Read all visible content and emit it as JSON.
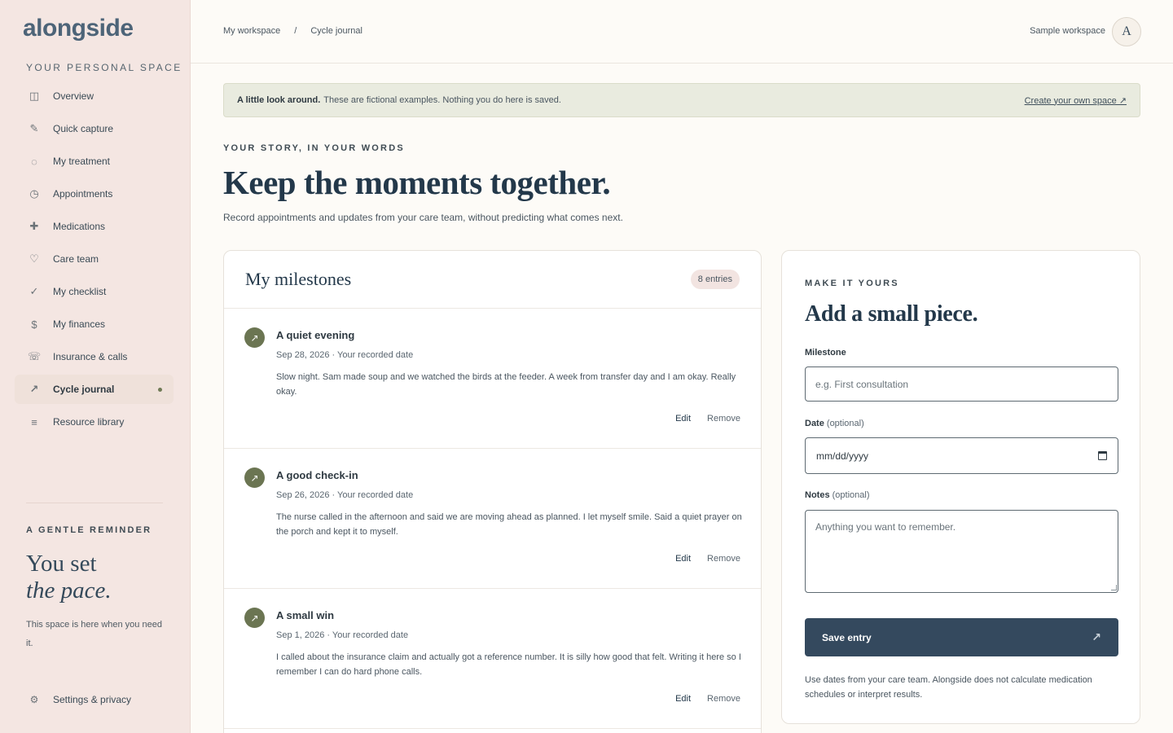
{
  "app": {
    "logo": "alongside",
    "sidebar_caption": "YOUR PERSONAL SPACE"
  },
  "sidebar": {
    "items": [
      {
        "label": "Overview",
        "icon": "layout-icon",
        "glyph": "◫"
      },
      {
        "label": "Quick capture",
        "icon": "pencil-icon",
        "glyph": "✎"
      },
      {
        "label": "My treatment",
        "icon": "circle-icon",
        "glyph": "◌"
      },
      {
        "label": "Appointments",
        "icon": "clock-icon",
        "glyph": "◷"
      },
      {
        "label": "Medications",
        "icon": "plus-icon",
        "glyph": "✚"
      },
      {
        "label": "Care team",
        "icon": "heart-icon",
        "glyph": "♡"
      },
      {
        "label": "My checklist",
        "icon": "check-icon",
        "glyph": "✓"
      },
      {
        "label": "My finances",
        "icon": "dollar-icon",
        "glyph": "$"
      },
      {
        "label": "Insurance & calls",
        "icon": "phone-icon",
        "glyph": "☏"
      },
      {
        "label": "Cycle journal",
        "icon": "arrow-icon",
        "glyph": "↗",
        "active": true
      },
      {
        "label": "Resource library",
        "icon": "library-icon",
        "glyph": "≡"
      }
    ],
    "reminder": {
      "caption": "A GENTLE REMINDER",
      "title_line1": "You set",
      "title_line2": "the pace.",
      "body": "This space is here when you need it."
    },
    "settings": {
      "label": "Settings & privacy",
      "glyph": "⚙"
    }
  },
  "header": {
    "breadcrumb": [
      "My workspace",
      "/",
      "Cycle journal"
    ],
    "workspace": "Sample workspace",
    "avatar": "A"
  },
  "banner": {
    "bold": "A little look around.",
    "text": "These are fictional examples. Nothing you do here is saved.",
    "link": "Create your own space ↗"
  },
  "hero": {
    "eyebrow": "YOUR STORY, IN YOUR WORDS",
    "title": "Keep the moments together.",
    "subtitle": "Record appointments and updates from your care team, without predicting what comes next."
  },
  "milestones": {
    "title": "My milestones",
    "badge": "8 entries",
    "edit_label": "Edit",
    "remove_label": "Remove",
    "entries": [
      {
        "title": "A quiet evening",
        "meta": "Sep 28, 2026 · Your recorded date",
        "body": "Slow night. Sam made soup and we watched the birds at the feeder. A week from transfer day and I am okay. Really okay."
      },
      {
        "title": "A good check-in",
        "meta": "Sep 26, 2026 · Your recorded date",
        "body": "The nurse called in the afternoon and said we are moving ahead as planned. I let myself smile. Said a quiet prayer on the porch and kept it to myself."
      },
      {
        "title": "A small win",
        "meta": "Sep 1, 2026 · Your recorded date",
        "body": "I called about the insurance claim and actually got a reference number. It is silly how good that felt. Writing it here so I remember I can do hard phone calls."
      }
    ]
  },
  "form": {
    "eyebrow": "MAKE IT YOURS",
    "title": "Add a small piece.",
    "milestone_label": "Milestone",
    "milestone_placeholder": "e.g. First consultation",
    "date_label": "Date",
    "date_optional": "(optional)",
    "date_value": "mm/dd/yyyy",
    "notes_label": "Notes",
    "notes_optional": "(optional)",
    "notes_placeholder": "Anything you want to remember.",
    "save_label": "Save entry",
    "note": "Use dates from your care team. Alongside does not calculate medication schedules or interpret results."
  },
  "colors": {
    "sidebar_bg": "#f4e6e2",
    "accent_navy": "#34495e",
    "accent_olive": "#6b7552",
    "banner_bg": "#e9ebdf"
  }
}
